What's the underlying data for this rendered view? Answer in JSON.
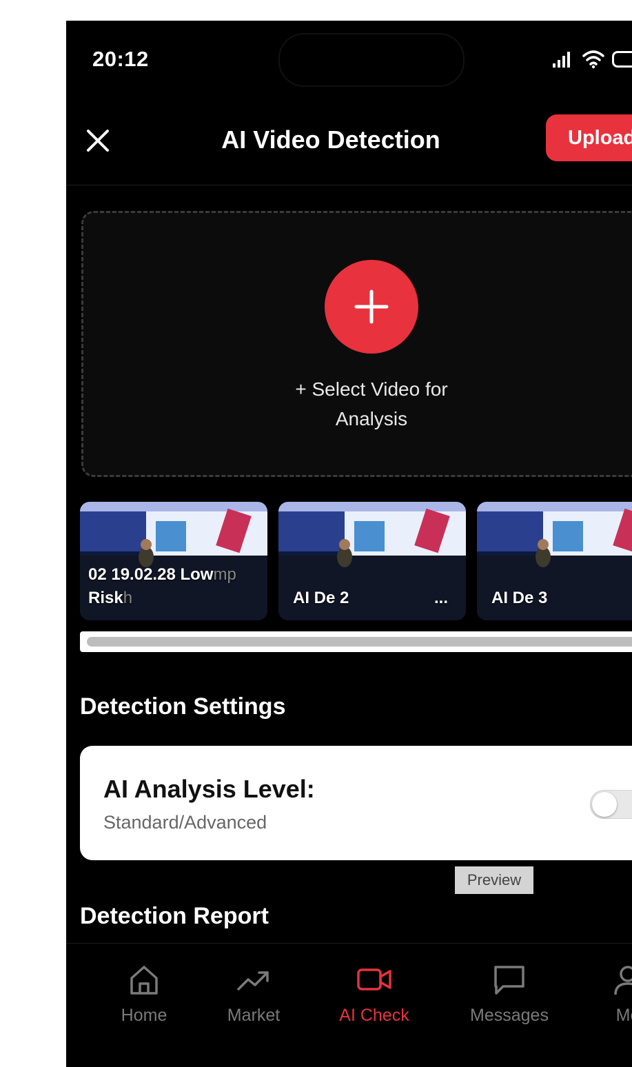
{
  "status_bar": {
    "time": "20:12"
  },
  "header": {
    "title": "AI Video Detection",
    "upload_label": "Upload"
  },
  "select_area": {
    "label": "+ Select Video for Analysis"
  },
  "thumbnails": [
    {
      "label_line1": "02 19.02.28 Low",
      "label_line1_faded": "mp",
      "label_line2": "Risk",
      "label_line2_faded": "h"
    },
    {
      "label": "AI De 2",
      "more": "..."
    },
    {
      "label": "AI De 3"
    }
  ],
  "settings": {
    "section_title": "Detection Settings",
    "analysis_level_title": "AI Analysis Level:",
    "analysis_level_subtitle": "Standard/Advanced",
    "toggle_on": false,
    "preview_label": "Preview"
  },
  "report": {
    "section_title": "Detection Report"
  },
  "tabs": [
    {
      "label": "Home",
      "icon": "home-icon",
      "active": false
    },
    {
      "label": "Market",
      "icon": "trending-up-icon",
      "active": false
    },
    {
      "label": "AI Check",
      "icon": "video-icon",
      "active": true
    },
    {
      "label": "Messages",
      "icon": "message-icon",
      "active": false
    },
    {
      "label": "Me",
      "icon": "user-icon",
      "active": false
    }
  ],
  "colors": {
    "accent": "#e8323d",
    "background": "#000000",
    "card": "#ffffff"
  }
}
